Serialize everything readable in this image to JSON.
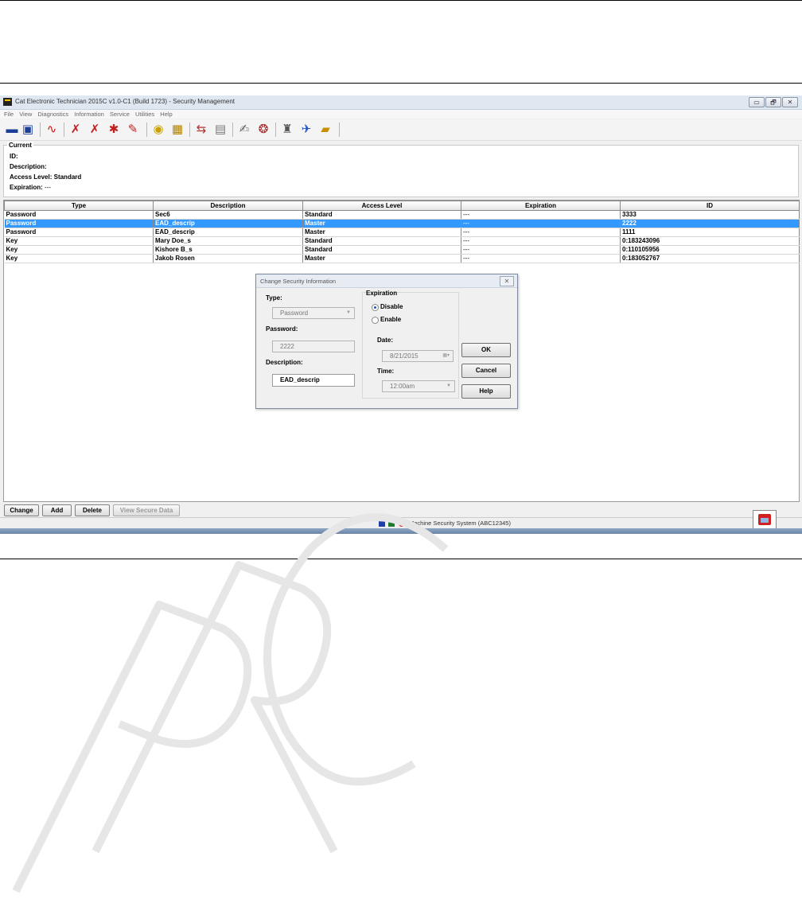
{
  "window": {
    "title": "Cat Electronic Technician 2015C v1.0-C1 (Build 1723) - Security Management",
    "controls": [
      "▭",
      "🗗",
      "✕"
    ]
  },
  "menu": [
    "File",
    "View",
    "Diagnostics",
    "Information",
    "Service",
    "Utilities",
    "Help"
  ],
  "toolbar_icons": [
    "connect-icon",
    "disconnect-icon",
    "status-graph-icon",
    "active-diag-icon",
    "logged-diag-icon",
    "events-icon",
    "clear-events-icon",
    "flash-icon",
    "config-icon",
    "calibrate-icon",
    "print-icon",
    "report-icon",
    "tools-icon",
    "security-icon",
    "ecu-icon",
    "lock-icon"
  ],
  "current": {
    "legend": "Current",
    "id_label": "ID:",
    "description_label": "Description:",
    "access_level_label": "Access Level:",
    "access_level_value": "Standard",
    "expiration_label": "Expiration:",
    "expiration_value": "---"
  },
  "table": {
    "columns": [
      "Type",
      "Description",
      "Access Level",
      "Expiration",
      "ID"
    ],
    "rows": [
      [
        "Password",
        "Sec6",
        "Standard",
        "---",
        "3333"
      ],
      [
        "Password",
        "EAD_descrip",
        "Master",
        "---",
        "2222"
      ],
      [
        "Password",
        "EAD_descrip",
        "Master",
        "---",
        "1111"
      ],
      [
        "Key",
        "Mary Doe_s",
        "Standard",
        "---",
        "0:183243096"
      ],
      [
        "Key",
        "Kishore B_s",
        "Standard",
        "---",
        "0:110105956"
      ],
      [
        "Key",
        "Jakob Rosen",
        "Master",
        "---",
        "0:183052767"
      ]
    ],
    "selected_row": 1
  },
  "dialog": {
    "title": "Change Security Information",
    "close": "✕",
    "type_label": "Type:",
    "type_value": "Password",
    "password_label": "Password:",
    "password_value": "2222",
    "description_label": "Description:",
    "description_value": "EAD_descrip",
    "expiration_label": "Expiration",
    "disable_label": "Disable",
    "enable_label": "Enable",
    "date_label": "Date:",
    "date_value": "8/21/2015",
    "time_label": "Time:",
    "time_value": "12:00am",
    "ok": "OK",
    "cancel": "Cancel",
    "help": "Help"
  },
  "buttons": {
    "change": "Change",
    "add": "Add",
    "delete": "Delete",
    "view_secure": "View Secure Data"
  },
  "status": {
    "text": "Machine Security System (ABC12345)",
    "colors": {
      "blue": "#1f3fa8",
      "green": "#1e7a2e",
      "red": "#d01010"
    }
  },
  "colors": {
    "selection": "#3399ff"
  }
}
